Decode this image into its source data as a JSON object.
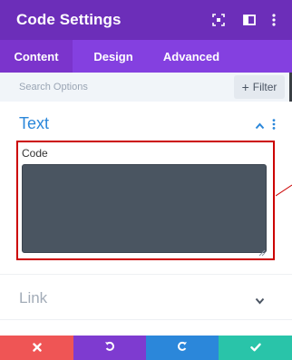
{
  "panel": {
    "title": "Code Settings",
    "colors": {
      "titlebar": "#6c2eb9",
      "tabs": "#8440e0",
      "accent": "#2b87da",
      "highlight": "#cc0000",
      "code_bg": "#4a5561"
    }
  },
  "header_icons": [
    "expand-icon",
    "sidebar-icon",
    "more-vertical-icon"
  ],
  "tabs": [
    {
      "label": "Content",
      "active": true
    },
    {
      "label": "Design",
      "active": false
    },
    {
      "label": "Advanced",
      "active": false
    }
  ],
  "search": {
    "placeholder": "Search Options",
    "value": "",
    "filter_label": "Filter"
  },
  "sections": {
    "text": {
      "title": "Text",
      "expanded": true,
      "code": {
        "label": "Code",
        "value": ""
      }
    },
    "link": {
      "title": "Link",
      "expanded": false
    }
  },
  "actions": [
    {
      "name": "cancel",
      "icon": "close-icon",
      "color": "#ef5555"
    },
    {
      "name": "undo",
      "icon": "undo-icon",
      "color": "#7e3bd0"
    },
    {
      "name": "redo",
      "icon": "redo-icon",
      "color": "#2b87da"
    },
    {
      "name": "save",
      "icon": "check-icon",
      "color": "#29c4a9"
    }
  ]
}
